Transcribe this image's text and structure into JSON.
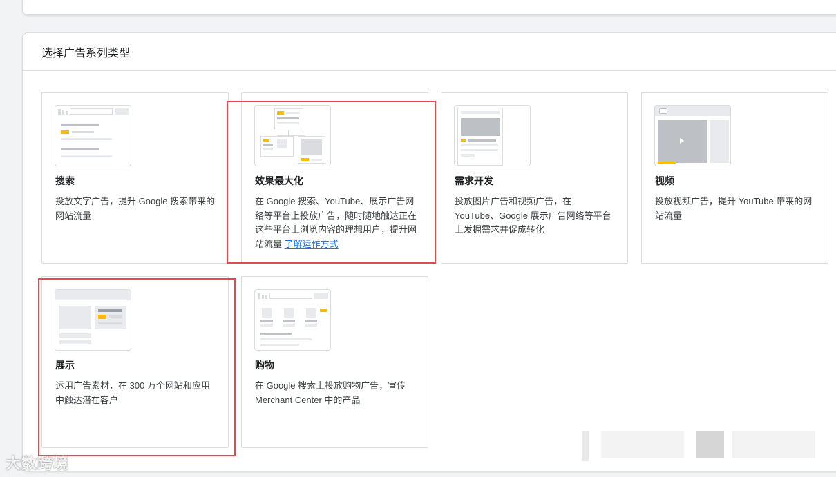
{
  "section_title": "选择广告系列类型",
  "campaign_types": [
    {
      "id": "search",
      "title": "搜索",
      "description": "投放文字广告，提升 Google 搜索带来的网站流量"
    },
    {
      "id": "performance-max",
      "title": "效果最大化",
      "description": "在 Google 搜索、YouTube、展示广告网络等平台上投放广告，随时随地触达正在这些平台上浏览内容的理想用户，提升网站流量 ",
      "link": "了解运作方式"
    },
    {
      "id": "demand-gen",
      "title": "需求开发",
      "description": "投放图片广告和视频广告，在 YouTube、Google 展示广告网络等平台上发掘需求并促成转化"
    },
    {
      "id": "video",
      "title": "视频",
      "description": "投放视频广告，提升 YouTube 带来的网站流量"
    },
    {
      "id": "display",
      "title": "展示",
      "description": "运用广告素材，在 300 万个网站和应用中触达潜在客户"
    },
    {
      "id": "shopping",
      "title": "购物",
      "description": "在 Google 搜索上投放购物广告，宣传 Merchant Center 中的产品"
    }
  ],
  "watermark": "大数跨境",
  "colors": {
    "accent_yellow": "#fbbc04",
    "link_blue": "#1a73e8",
    "highlight_red": "#e5484d"
  },
  "icons": [
    "search-thumbnail-icon",
    "performance-max-thumbnail-icon",
    "demand-gen-thumbnail-icon",
    "video-thumbnail-icon",
    "play-icon",
    "display-thumbnail-icon",
    "shopping-thumbnail-icon"
  ]
}
